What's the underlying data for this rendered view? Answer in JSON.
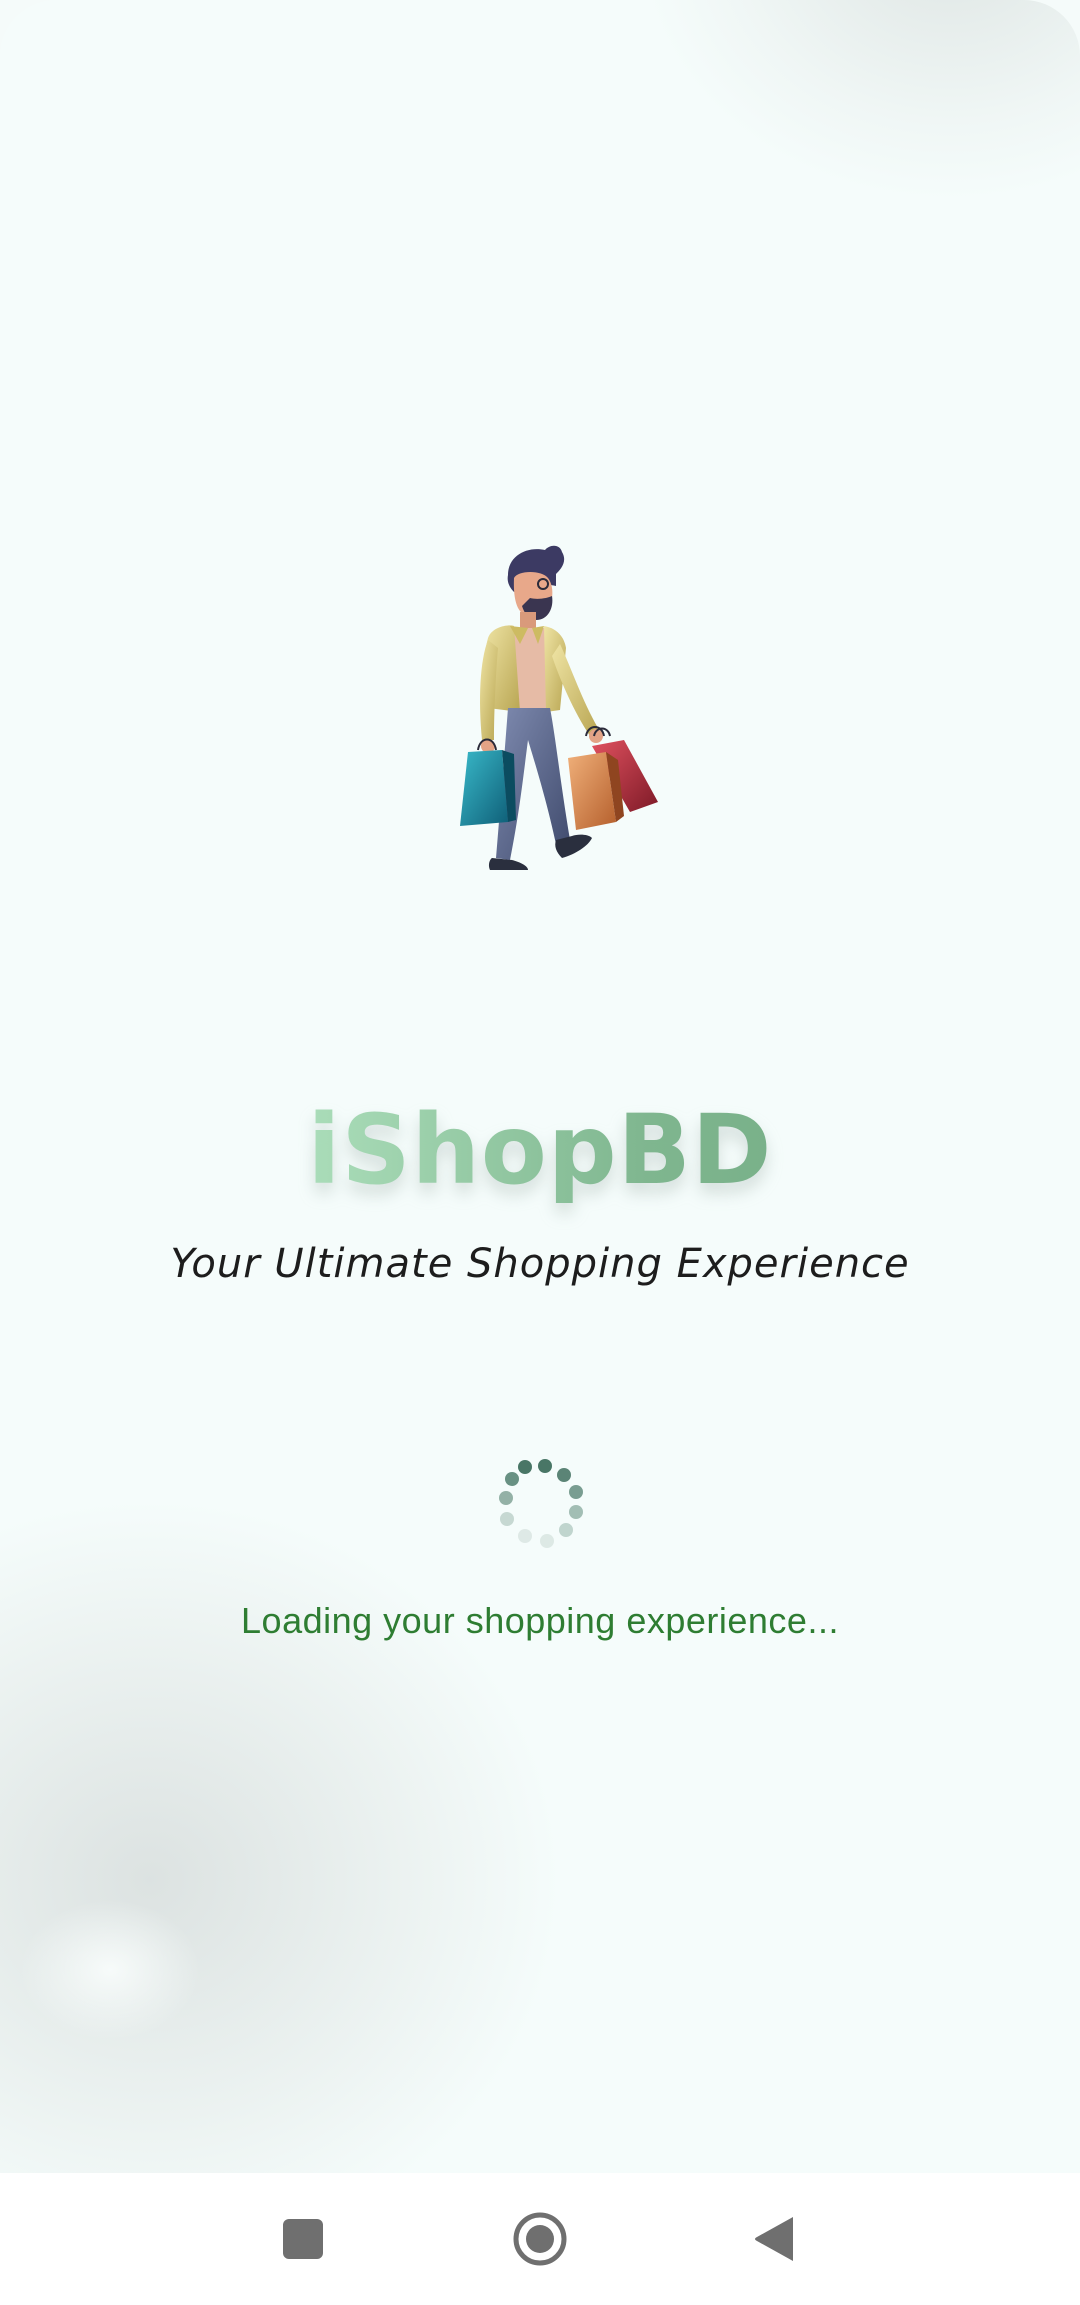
{
  "app": {
    "name": "iShopBD",
    "tagline": "Your Ultimate Shopping Experience",
    "loading_message": "Loading your shopping experience..."
  },
  "illustration": {
    "icon": "shopper-with-bags-illustration"
  },
  "spinner": {
    "icon": "dotted-loading-spinner",
    "color": "#3f6f5e"
  },
  "system_nav": {
    "recents_icon": "square-recents-icon",
    "home_icon": "circle-home-icon",
    "back_icon": "triangle-back-icon"
  },
  "colors": {
    "background": "#f5fcfb",
    "brand_gradient_start": "#c7f0d6",
    "brand_gradient_end": "#6aa47c",
    "loading_text": "#2e7d32",
    "nav_icon": "#6f6f6f"
  }
}
